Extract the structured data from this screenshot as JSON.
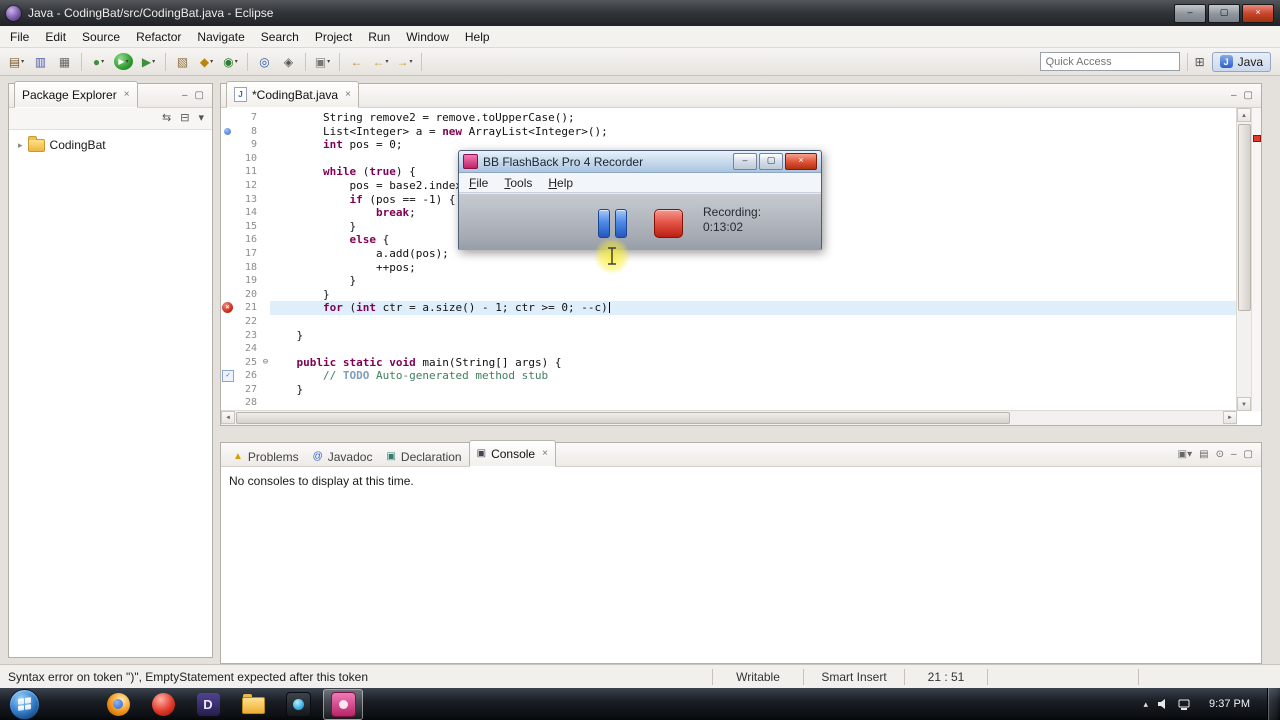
{
  "icons": {
    "minimize": "–",
    "maximize": "▢",
    "close": "×",
    "dropdown": "▾",
    "java_letter": "J",
    "expander": "▸",
    "fold_collapse": "⊖",
    "up_arrow": "▲",
    "down_arrow": "▼",
    "left_arrow": "◄",
    "right_arrow": "►",
    "chevron_up": "▴",
    "open_perspective": "⊞"
  },
  "titlebar": {
    "title": "Java - CodingBat/src/CodingBat.java - Eclipse"
  },
  "menubar": {
    "items": [
      "File",
      "Edit",
      "Source",
      "Refactor",
      "Navigate",
      "Search",
      "Project",
      "Run",
      "Window",
      "Help"
    ]
  },
  "toolbar": {
    "quick_access": "Quick Access",
    "perspective": "Java",
    "icons": [
      {
        "n": "new-wizard-icon",
        "g": "▤",
        "col": "#7a5c2e",
        "d": 1
      },
      {
        "n": "save-icon",
        "g": "▥",
        "col": "#4a5fb0"
      },
      {
        "n": "print-icon",
        "g": "▦",
        "col": "#666666"
      },
      {
        "sep": 1
      },
      {
        "n": "debug-icon",
        "g": "●",
        "col": "#3f8f3f",
        "d": 1
      },
      {
        "n": "run-icon",
        "g": "▶",
        "cls": "run",
        "col": "#ffffff",
        "d": 1
      },
      {
        "n": "external-tools-icon",
        "g": "▶",
        "col": "#3f8f3f",
        "d": 1
      },
      {
        "sep": 1
      },
      {
        "n": "new-java-project-icon",
        "g": "▧",
        "col": "#8a6d3b"
      },
      {
        "n": "new-package-icon",
        "g": "◆",
        "col": "#b8860b",
        "d": 1
      },
      {
        "n": "new-class-icon",
        "g": "◉",
        "col": "#2e7d32",
        "d": 1
      },
      {
        "sep": 1
      },
      {
        "n": "open-type-icon",
        "g": "◎",
        "col": "#30609f"
      },
      {
        "n": "search-icon",
        "g": "◈",
        "col": "#555555"
      },
      {
        "sep": 1
      },
      {
        "n": "mark-occurrences-icon",
        "g": "▣",
        "col": "#777777",
        "d": 1
      },
      {
        "sep": 1
      },
      {
        "n": "last-edit-location-icon",
        "g": "←",
        "col": "#c08a2d"
      },
      {
        "n": "back-icon",
        "g": "←",
        "col": "#caa12f",
        "d": 1
      },
      {
        "n": "forward-icon",
        "g": "→",
        "col": "#caa12f",
        "d": 1
      },
      {
        "sep": 1
      }
    ]
  },
  "explorer": {
    "tab": "Package Explorer",
    "project": "CodingBat",
    "toolbar_icons": [
      {
        "n": "link-with-editor-icon",
        "g": "⇆"
      },
      {
        "n": "collapse-all-icon",
        "g": "⊟"
      },
      {
        "n": "view-menu-icon",
        "g": "▾"
      }
    ]
  },
  "editor": {
    "tab": "*CodingBat.java",
    "lines": [
      {
        "n": 7,
        "seg": [
          [
            "p",
            "        String remove2 = remove.toUpperCase();"
          ]
        ]
      },
      {
        "n": 8,
        "m": "info",
        "seg": [
          [
            "p",
            "        List<Integer> a = "
          ],
          [
            "k",
            "new"
          ],
          [
            "p",
            " ArrayList<Integer>();"
          ]
        ]
      },
      {
        "n": 9,
        "seg": [
          [
            "p",
            "        "
          ],
          [
            "k",
            "int"
          ],
          [
            "p",
            " pos = 0;"
          ]
        ]
      },
      {
        "n": 10,
        "seg": []
      },
      {
        "n": 11,
        "seg": [
          [
            "p",
            "        "
          ],
          [
            "k",
            "while"
          ],
          [
            "p",
            " ("
          ],
          [
            "k",
            "true"
          ],
          [
            "p",
            ") {"
          ]
        ]
      },
      {
        "n": 12,
        "seg": [
          [
            "p",
            "            pos = base2.indexO"
          ]
        ]
      },
      {
        "n": 13,
        "seg": [
          [
            "p",
            "            "
          ],
          [
            "k",
            "if"
          ],
          [
            "p",
            " (pos == -1) {"
          ]
        ]
      },
      {
        "n": 14,
        "seg": [
          [
            "p",
            "                "
          ],
          [
            "k",
            "break"
          ],
          [
            "p",
            ";"
          ]
        ]
      },
      {
        "n": 15,
        "seg": [
          [
            "p",
            "            }"
          ]
        ]
      },
      {
        "n": 16,
        "seg": [
          [
            "p",
            "            "
          ],
          [
            "k",
            "else"
          ],
          [
            "p",
            " {"
          ]
        ]
      },
      {
        "n": 17,
        "seg": [
          [
            "p",
            "                a.add(pos);"
          ]
        ]
      },
      {
        "n": 18,
        "seg": [
          [
            "p",
            "                ++pos;"
          ]
        ]
      },
      {
        "n": 19,
        "seg": [
          [
            "p",
            "            }"
          ]
        ]
      },
      {
        "n": 20,
        "seg": [
          [
            "p",
            "        }"
          ]
        ]
      },
      {
        "n": 21,
        "m": "error",
        "cur": true,
        "caret": true,
        "seg": [
          [
            "p",
            "        "
          ],
          [
            "k",
            "for"
          ],
          [
            "p",
            " ("
          ],
          [
            "k",
            "int"
          ],
          [
            "p",
            " ctr = a.size() - 1; ctr >= 0; --c)"
          ]
        ]
      },
      {
        "n": 22,
        "seg": []
      },
      {
        "n": 23,
        "seg": [
          [
            "p",
            "    }"
          ]
        ]
      },
      {
        "n": 24,
        "seg": []
      },
      {
        "n": 25,
        "fold": true,
        "seg": [
          [
            "p",
            "    "
          ],
          [
            "k",
            "public"
          ],
          [
            "p",
            " "
          ],
          [
            "k",
            "static"
          ],
          [
            "p",
            " "
          ],
          [
            "k",
            "void"
          ],
          [
            "p",
            " main(String[] args) {"
          ]
        ]
      },
      {
        "n": 26,
        "m": "task",
        "seg": [
          [
            "c",
            "        // "
          ],
          [
            "t",
            "TODO"
          ],
          [
            "c",
            " Auto-generated method stub"
          ]
        ]
      },
      {
        "n": 27,
        "seg": [
          [
            "p",
            "    }"
          ]
        ]
      },
      {
        "n": 28,
        "seg": []
      }
    ]
  },
  "recorder": {
    "title": "BB FlashBack Pro 4 Recorder",
    "menu": [
      "File",
      "Tools",
      "Help"
    ],
    "recording_label": "Recording:",
    "time": "0:13:02"
  },
  "console": {
    "tabs": [
      {
        "label": "Problems",
        "icon": "problems-icon",
        "g": "▲",
        "col": "#d89e00"
      },
      {
        "label": "Javadoc",
        "icon": "javadoc-icon",
        "g": "@",
        "col": "#2a5fd0"
      },
      {
        "label": "Declaration",
        "icon": "declaration-icon",
        "g": "▣",
        "col": "#2e7d6e"
      },
      {
        "label": "Console",
        "icon": "console-icon",
        "g": "▣",
        "col": "#444455",
        "selected": true
      }
    ],
    "message": "No consoles to display at this time.",
    "toolbar_icons": [
      {
        "n": "open-console-icon",
        "g": "▣",
        "d": 1
      },
      {
        "n": "display-selected-console-icon",
        "g": "▤"
      },
      {
        "n": "pin-console-icon",
        "g": "⊙"
      }
    ]
  },
  "statusbar": {
    "message": "Syntax error on token \")\", EmptyStatement expected after this token",
    "cells": [
      "Writable",
      "Smart Insert",
      "21 : 51"
    ]
  },
  "taskbar": {
    "time": "9:37 PM",
    "icons": [
      {
        "n": "taskbar-firefox-icon",
        "cls": "tb-ff"
      },
      {
        "n": "taskbar-opera-icon",
        "cls": "tb-red"
      },
      {
        "n": "taskbar-app-d-icon",
        "cls": "tb-d",
        "letter": "D"
      },
      {
        "n": "taskbar-folder-icon",
        "cls": "tb-folder"
      },
      {
        "n": "taskbar-media-player-icon",
        "cls": "tb-media"
      },
      {
        "n": "taskbar-flashback-icon",
        "cls": "tb-fb",
        "active": true
      }
    ]
  }
}
